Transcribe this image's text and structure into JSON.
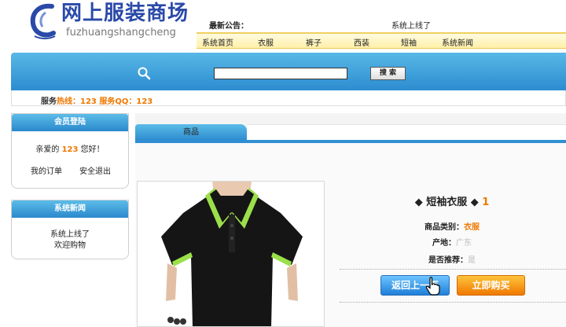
{
  "header": {
    "logo_title": "网上服装商场",
    "logo_subtitle": "fuzhuangshangcheng",
    "notice_label": "最新公告：",
    "notice_text": "系统上线了",
    "nav": [
      "系统首页",
      "衣服",
      "裤子",
      "西装",
      "短袖",
      "系统新闻"
    ]
  },
  "search": {
    "value": "",
    "button_label": "搜 索"
  },
  "hotline": {
    "prefix": "服务",
    "hot": "热线",
    "colon1": "：123 服务",
    "qq": "QQ",
    "colon2": "：123"
  },
  "login_panel": {
    "title": "会员登陆",
    "greeting_pre": "亲爱的 ",
    "username": "123",
    "greeting_post": " 您好！",
    "my_orders": "我的订单",
    "logout": "安全退出"
  },
  "news_panel": {
    "title": "系统新闻",
    "items": [
      "系统上线了",
      "欢迎购物"
    ]
  },
  "main": {
    "tab_label": "商品"
  },
  "product": {
    "name_prefix": "◆ 短袖衣服 ◆ ",
    "name_num": "1",
    "category_label": "商品类别：",
    "category_value": "衣服",
    "origin_label": "产地：",
    "origin_value": "广东",
    "recommend_label": "是否推荐：",
    "recommend_value": "是",
    "back_button": "返回上一页",
    "buy_button": "立即购买"
  },
  "colors": {
    "accent_blue": "#2f8fd2",
    "accent_orange": "#f07800",
    "logo_blue": "#2a49a8"
  }
}
